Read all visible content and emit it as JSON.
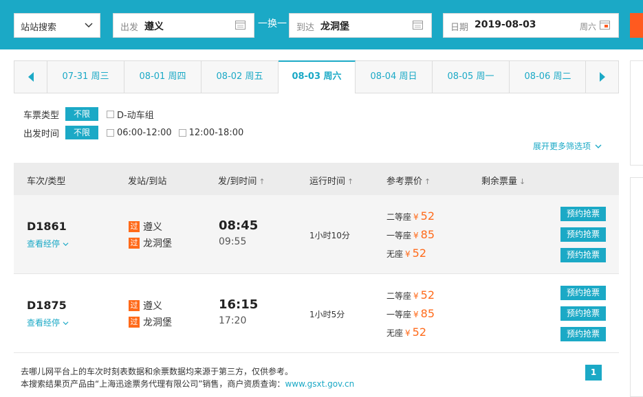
{
  "search": {
    "mode": "站站搜索",
    "from_label": "出发",
    "from_value": "遵义",
    "swap_label": "一换一",
    "to_label": "到达",
    "to_value": "龙洞堡",
    "date_label": "日期",
    "date_value": "2019-08-03",
    "date_weekday": "周六"
  },
  "date_tabs": [
    {
      "label": "07-31 周三"
    },
    {
      "label": "08-01 周四"
    },
    {
      "label": "08-02 周五"
    },
    {
      "label": "08-03 周六",
      "active": true
    },
    {
      "label": "08-04 周日"
    },
    {
      "label": "08-05 周一"
    },
    {
      "label": "08-06 周二"
    }
  ],
  "filters": {
    "ticket_type_label": "车票类型",
    "ticket_type_pill": "不限",
    "ticket_type_option": "D-动车组",
    "depart_time_label": "出发时间",
    "depart_time_pill": "不限",
    "depart_time_options": [
      "06:00-12:00",
      "12:00-18:00"
    ],
    "expand_label": "展开更多筛选项"
  },
  "table": {
    "headers": [
      "车次/类型",
      "发站/到站",
      "发/到时间",
      "运行时间",
      "参考票价",
      "剩余票量"
    ],
    "rows": [
      {
        "train": "D1861",
        "stops_label": "查看经停",
        "from_tag": "过",
        "from_station": "遵义",
        "to_tag": "过",
        "to_station": "龙洞堡",
        "depart": "08:45",
        "arrive": "09:55",
        "duration": "1小时10分",
        "prices": [
          {
            "seat": "二等座",
            "currency": "¥",
            "value": "52"
          },
          {
            "seat": "一等座",
            "currency": "¥",
            "value": "85"
          },
          {
            "seat": "无座",
            "currency": "¥",
            "value": "52"
          }
        ],
        "book_label": "预约抢票"
      },
      {
        "train": "D1875",
        "stops_label": "查看经停",
        "from_tag": "过",
        "from_station": "遵义",
        "to_tag": "过",
        "to_station": "龙洞堡",
        "depart": "16:15",
        "arrive": "17:20",
        "duration": "1小时5分",
        "prices": [
          {
            "seat": "二等座",
            "currency": "¥",
            "value": "52"
          },
          {
            "seat": "一等座",
            "currency": "¥",
            "value": "85"
          },
          {
            "seat": "无座",
            "currency": "¥",
            "value": "52"
          }
        ],
        "book_label": "预约抢票"
      }
    ]
  },
  "footer": {
    "line1": "去哪儿网平台上的车次时刻表数据和余票数据均来源于第三方，仅供参考。",
    "line2_prefix": "本搜索结果页产品由“上海迅途票务代理有限公司”销售，商户资质查询：",
    "line2_link": "www.gsxt.gov.cn",
    "page": "1"
  },
  "colors": {
    "primary": "#1ba9c6",
    "price": "#ff6a1a",
    "search_button": "#ff5a1f"
  }
}
